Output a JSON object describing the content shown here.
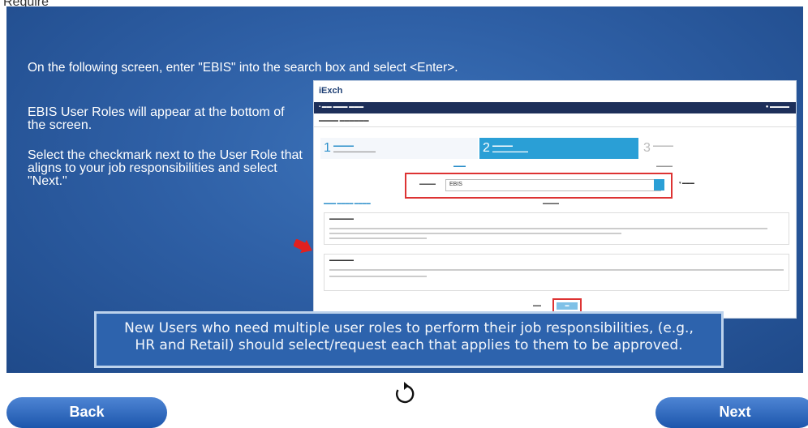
{
  "header": {
    "partial_text": "Require"
  },
  "slide": {
    "instruction_1": "On the following screen, enter \"EBIS\" into the search box and select <Enter>.",
    "instruction_2": "EBIS User Roles will appear at the bottom of the screen.",
    "instruction_3": "Select the checkmark next to the User Role that aligns to your job responsibilities and select \"Next.\"",
    "note_line_1": "New Users who need multiple user roles to perform their job responsibilities, (e.g.,",
    "note_line_2": "HR and Retail) should select/request each that applies to them to be approved."
  },
  "embedded_screenshot": {
    "logo": "iExch",
    "search_value": "EBIS",
    "steps": [
      "1",
      "2",
      "3"
    ]
  },
  "controls": {
    "back_label": "Back",
    "next_label": "Next",
    "replay_icon": "replay-icon"
  },
  "colors": {
    "slide_blue": "#2e5fa5",
    "button_blue": "#1c56ac",
    "highlight_red": "#dd3333"
  }
}
